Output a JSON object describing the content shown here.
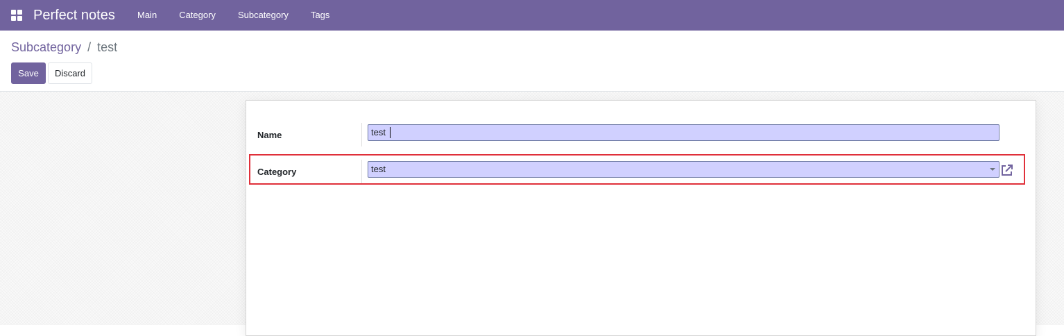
{
  "app": {
    "title": "Perfect notes"
  },
  "menu": {
    "items": [
      "Main",
      "Category",
      "Subcategory",
      "Tags"
    ]
  },
  "breadcrumb": {
    "parent": "Subcategory",
    "separator": "/",
    "current": "test"
  },
  "buttons": {
    "save": "Save",
    "discard": "Discard"
  },
  "form": {
    "name": {
      "label": "Name",
      "value": "test"
    },
    "category": {
      "label": "Category",
      "value": "test"
    }
  },
  "icons": {
    "apps": "apps-grid-icon",
    "external": "external-link-icon",
    "dropdown": "caret-down-icon"
  },
  "colors": {
    "brand": "#71639e",
    "field_bg": "#d0d0ff",
    "highlight": "#e0303a"
  }
}
